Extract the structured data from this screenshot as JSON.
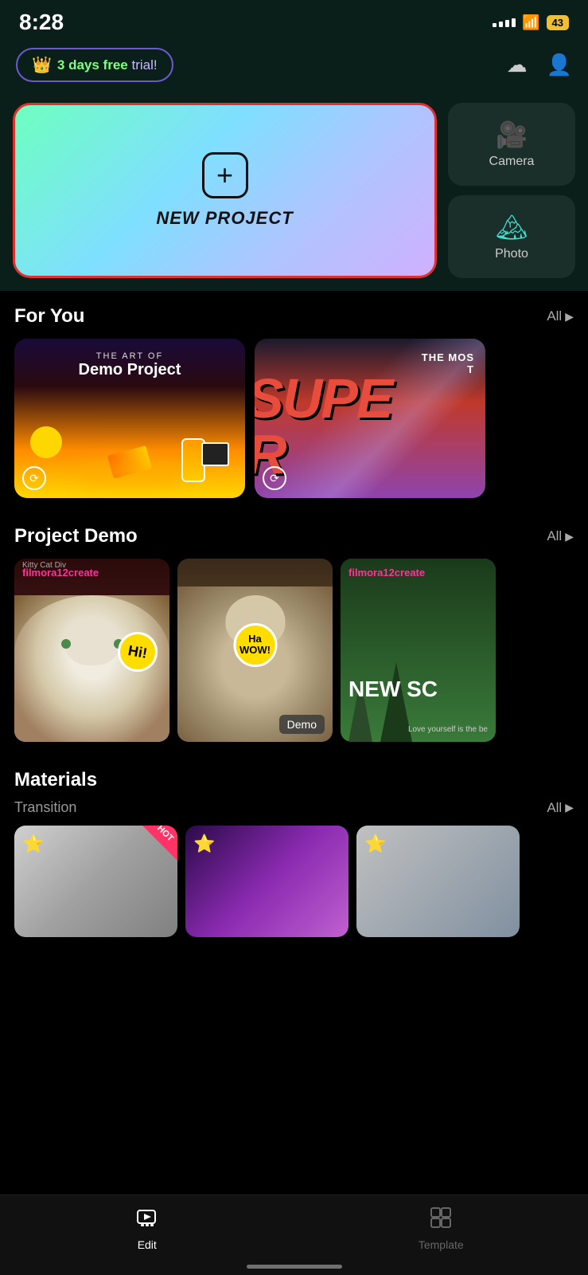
{
  "status": {
    "time": "8:28",
    "battery": "43"
  },
  "header": {
    "trial_text": "3 days free",
    "trial_suffix": " trial!",
    "cloud_icon": "☁",
    "user_icon": "👤"
  },
  "new_project": {
    "label": "NEW PROJECT"
  },
  "quick_buttons": [
    {
      "id": "camera",
      "label": "Camera",
      "icon": "📹"
    },
    {
      "id": "photo",
      "label": "Photo",
      "icon": "🌄"
    }
  ],
  "for_you": {
    "title": "For You",
    "all_label": "All",
    "cards": [
      {
        "id": "demo-project",
        "subtitle": "THE ART OF",
        "title": "Demo Project"
      },
      {
        "id": "super",
        "top_text": "THE MOS",
        "big_text": "SUPE"
      }
    ]
  },
  "project_demo": {
    "title": "Project Demo",
    "all_label": "All",
    "cards": [
      {
        "id": "cat1",
        "tag": "filmora12create",
        "kitty": "Kitty Cat Div"
      },
      {
        "id": "cat2",
        "badge": "Demo"
      },
      {
        "id": "cat3",
        "tag": "filmora12create",
        "text": "NEW SC"
      }
    ]
  },
  "materials": {
    "title": "Materials",
    "transition_label": "Transition",
    "all_label": "All",
    "cards": [
      {
        "id": "m1",
        "hot": true
      },
      {
        "id": "m2"
      },
      {
        "id": "m3"
      }
    ]
  },
  "bottom_nav": {
    "items": [
      {
        "id": "edit",
        "label": "Edit",
        "active": true
      },
      {
        "id": "template",
        "label": "Template",
        "active": false
      }
    ]
  }
}
